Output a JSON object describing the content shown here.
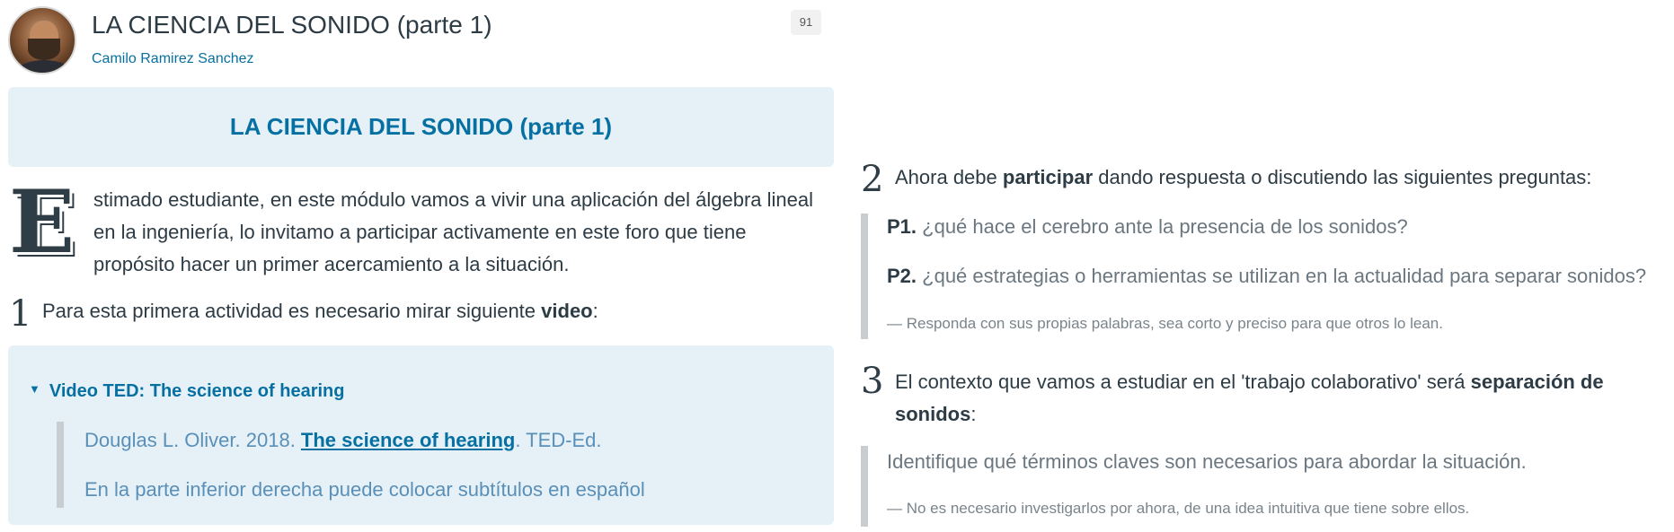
{
  "header": {
    "title": "LA CIENCIA DEL SONIDO (parte 1)",
    "author": "Camilo Ramirez Sanchez",
    "count": "91"
  },
  "banner": {
    "title": "LA CIENCIA DEL SONIDO (parte 1)"
  },
  "intro": {
    "drop_cap": "E",
    "text": "stimado estudiante, en este módulo vamos a vivir una aplicación del álgebra lineal en la ingeniería, lo invitamo a participar activamente en este foro que tiene propósito hacer un primer acercamiento a la situación."
  },
  "step1": {
    "number": "1",
    "text_before": "Para esta primera actividad es necesario mirar siguiente ",
    "text_bold": "video",
    "text_after": ":"
  },
  "video": {
    "summary": "Video TED: The science of hearing",
    "ref_prefix": "Douglas L. Oliver. 2018. ",
    "ref_link": "The science of hearing",
    "ref_suffix": ". TED-Ed.",
    "subtitles_note": "En la parte inferior derecha puede colocar subtítulos en español"
  },
  "step2": {
    "number": "2",
    "text_before": "Ahora debe ",
    "text_bold": "participar",
    "text_after": " dando respuesta o discutiendo las siguientes preguntas:",
    "questions": [
      {
        "label": "P1.",
        "text": " ¿qué hace el cerebro ante la presencia de los sonidos?"
      },
      {
        "label": "P2.",
        "text": " ¿qué estrategias o herramientas se utilizan en la actualidad para separar sonidos?"
      }
    ],
    "note": "— Responda con sus propias palabras, sea corto y preciso para que otros lo lean."
  },
  "step3": {
    "number": "3",
    "text_before": "El contexto que vamos a estudiar en el 'trabajo colaborativo' será ",
    "text_bold": "separación de sonidos",
    "text_after": ":",
    "instruction": "Identifique qué términos claves son necesarios para abordar la situación.",
    "note": "— No es necesario investigarlos por ahora, de una idea intuitiva que tiene sobre ellos."
  },
  "colors": {
    "link_blue": "#0770a3",
    "panel_bg": "#e5f1f7",
    "text": "#2d3b45",
    "muted": "#6b7780"
  }
}
